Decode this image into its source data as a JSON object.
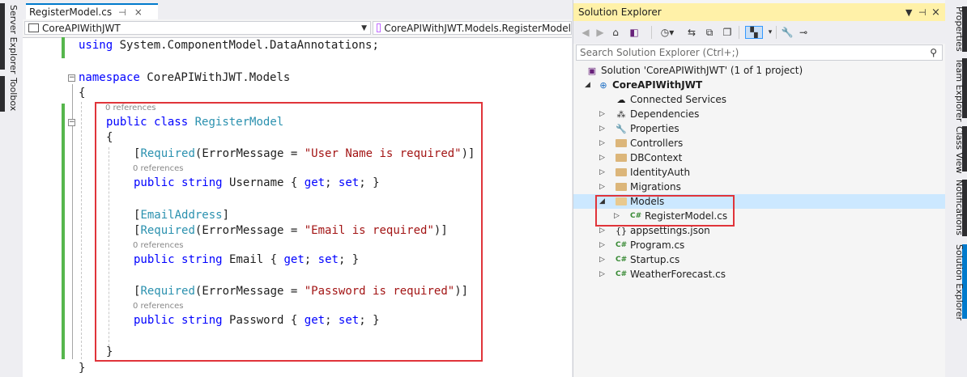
{
  "left_rail": {
    "server_explorer": "Server Explorer",
    "toolbox": "Toolbox"
  },
  "right_rail": {
    "properties": "Properties",
    "team_explorer": "Team Explorer",
    "class_view": "Class View",
    "notifications": "Notifications",
    "solution_explorer": "Solution Explorer"
  },
  "editor": {
    "tab": {
      "title": "RegisterModel.cs",
      "pin": "⊣",
      "close": "×"
    },
    "nav": {
      "project": "CoreAPIWithJWT",
      "type": "CoreAPIWithJWT.Models.RegisterModel"
    },
    "code": {
      "l1_kw": "using",
      "l1_rest": " System.ComponentModel.DataAnnotations;",
      "l2_kw": "namespace",
      "l2_rest": " CoreAPIWithJWT.Models",
      "brace_open": "{",
      "refs": "0 references",
      "class_kw1": "public",
      "class_kw2": "class",
      "class_name": "RegisterModel",
      "required": "Required",
      "error_message": "ErrorMessage = ",
      "username_msg": "\"User Name is required\"",
      "email_msg": "\"Email is required\"",
      "password_msg": "\"Password is required\"",
      "email_attr": "EmailAddress",
      "public": "public",
      "string": "string",
      "username": "Username",
      "email": "Email",
      "password": "Password",
      "get": "get",
      "set": "set",
      "brace_close": "}"
    }
  },
  "solution_explorer": {
    "title": "Solution Explorer",
    "search_placeholder": "Search Solution Explorer (Ctrl+;)",
    "items": [
      {
        "label": "Solution 'CoreAPIWithJWT' (1 of 1 project)"
      },
      {
        "label": "CoreAPIWithJWT"
      },
      {
        "label": "Connected Services"
      },
      {
        "label": "Dependencies"
      },
      {
        "label": "Properties"
      },
      {
        "label": "Controllers"
      },
      {
        "label": "DBContext"
      },
      {
        "label": "IdentityAuth"
      },
      {
        "label": "Migrations"
      },
      {
        "label": "Models"
      },
      {
        "label": "RegisterModel.cs"
      },
      {
        "label": "appsettings.json"
      },
      {
        "label": "Program.cs"
      },
      {
        "label": "Startup.cs"
      },
      {
        "label": "WeatherForecast.cs"
      }
    ]
  },
  "colors": {
    "accent": "#007acc",
    "keyword": "#0000ff",
    "type": "#2b91af",
    "string": "#a31515",
    "highlight_box": "#e0343a",
    "title_bar": "#fff1a8"
  }
}
